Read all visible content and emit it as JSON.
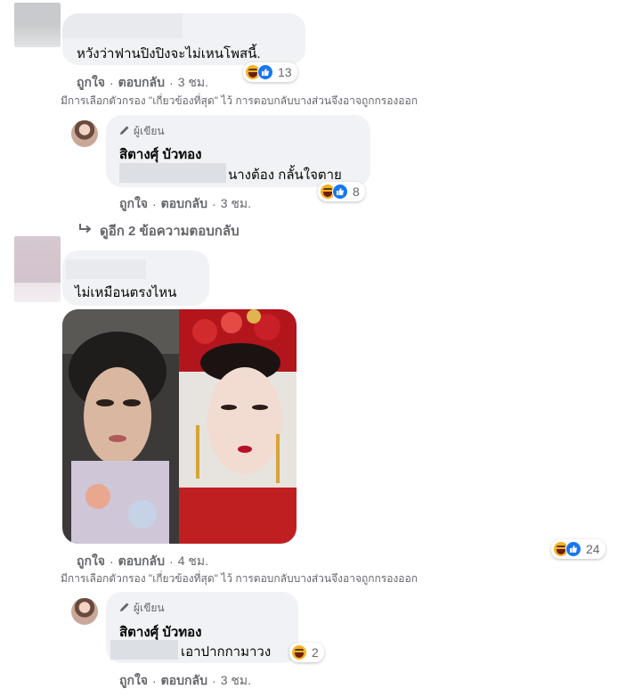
{
  "comment1": {
    "text": "หวังว่าฟานปิงปิงจะไม่เหนโพสนี้.",
    "reaction_count": "13",
    "actions": {
      "like": "ถูกใจ",
      "reply": "ตอบกลับ",
      "time": "3 ชม."
    },
    "filter_note": "มีการเลือกตัวกรอง \"เกี่ยวข้องที่สุด\" ไว้ การตอบกลับบางส่วนจึงอาจถูกกรองออก"
  },
  "reply1": {
    "author_tag": "ผู้เขียน",
    "author_name": "สิตางศุ์ บัวทอง",
    "text": "นางต้อง กลั้นใจตาย",
    "reaction_count": "8",
    "actions": {
      "like": "ถูกใจ",
      "reply": "ตอบกลับ",
      "time": "3 ชม."
    }
  },
  "more_replies": "ดูอีก 2 ข้อความตอบกลับ",
  "comment2": {
    "text": "ไม่เหมือนตรงไหน",
    "reaction_count": "24",
    "actions": {
      "like": "ถูกใจ",
      "reply": "ตอบกลับ",
      "time": "4 ชม."
    },
    "filter_note": "มีการเลือกตัวกรอง \"เกี่ยวข้องที่สุด\" ไว้ การตอบกลับบางส่วนจึงอาจถูกกรองออก"
  },
  "reply2": {
    "author_tag": "ผู้เขียน",
    "author_name": "สิตางศุ์ บัวทอง",
    "text": "เอาปากกามาวง",
    "reaction_count": "2",
    "actions": {
      "like": "ถูกใจ",
      "reply": "ตอบกลับ",
      "time": "3 ชม."
    }
  },
  "colors": {
    "bubble": "#f0f2f5",
    "secondary_text": "#65676b",
    "like_blue": "#1877f2",
    "haha_yellow": "#f7b125"
  },
  "icons": [
    "haha-emoji-icon",
    "like-emoji-icon",
    "pencil-icon",
    "reply-arrow-icon"
  ]
}
